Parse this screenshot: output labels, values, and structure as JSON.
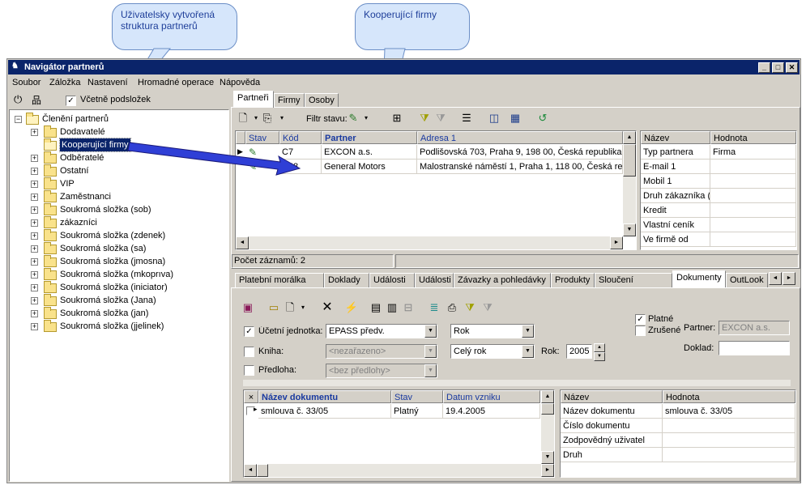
{
  "callouts": {
    "left": "Uživatelsky vytvořená struktura partnerů",
    "right": "Kooperující firmy"
  },
  "window": {
    "title": "Navigátor partnerů",
    "buttons": {
      "minimize": "_",
      "maximize": "□",
      "close": "✕"
    }
  },
  "menu": [
    "Soubor",
    "Záložka",
    "Nastavení",
    "Hromadné operace",
    "Nápověda"
  ],
  "left_toolbar": {
    "include_label": "Včetně podsložek",
    "include_checked": "✓"
  },
  "tree": {
    "root": "Členění partnerů",
    "items": [
      "Dodavatelé",
      "Kooperující firmy",
      "Odběratelé",
      "Ostatní",
      "VIP",
      "Zaměstnanci",
      "Soukromá složka (sob)",
      "zákazníci",
      "Soukromá složka (zdenek)",
      "Soukromá složka (sa)",
      "Soukromá složka (jmosna)",
      "Soukromá složka (mkoprıva)",
      "Soukromá složka (iniciator)",
      "Soukromá složka (Jana)",
      "Soukromá složka (jan)",
      "Soukromá složka (jjelinek)"
    ]
  },
  "top_tabs": [
    "Partneři",
    "Firmy",
    "Osoby"
  ],
  "filter_label": "Filtr stavu:",
  "grid": {
    "headers": [
      "Stav",
      "Kód",
      "Partner",
      "Adresa 1"
    ],
    "rows": [
      [
        "C7",
        "EXCON a.s.",
        "Podlišovská 703, Praha 9, 198 00, Česká republika"
      ],
      [
        "C48",
        "General Motors",
        "Malostranské náměstí 1, Praha 1, 118 00, Česká repu"
      ]
    ]
  },
  "props": {
    "headers": [
      "Název",
      "Hodnota"
    ],
    "rows": [
      [
        "Typ partnera",
        "Firma"
      ],
      [
        "E-mail 1",
        ""
      ],
      [
        "Mobil 1",
        ""
      ],
      [
        "Druh zákazníka (",
        ""
      ],
      [
        "Kredit",
        ""
      ],
      [
        "Vlastní ceník",
        ""
      ],
      [
        "Ve firmě od",
        ""
      ]
    ]
  },
  "status": "Počet záznamů: 2",
  "bottom_tabs": [
    "Platební morálka",
    "Doklady",
    "Události",
    "Události",
    "Závazky a pohledávky",
    "Produkty",
    "Sloučení partnerů",
    "Dokumenty",
    "OutLook"
  ],
  "doc_form": {
    "ucetni_label": "Účetní jednotka:",
    "ucetni_value": "EPASS předv.",
    "ucetni_checked": "✓",
    "kniha_label": "Kniha:",
    "kniha_value": "<nezařazeno>",
    "predloha_label": "Předloha:",
    "predloha_value": "<bez předlohy>",
    "period": "Rok",
    "period2": "Celý rok",
    "rok_label": "Rok:",
    "rok_value": "2005",
    "platne_label": "Platné",
    "platne_checked": "✓",
    "zrusene_label": "Zrušené",
    "partner_label": "Partner:",
    "partner_value": "EXCON a.s.",
    "doklad_label": "Doklad:"
  },
  "docs": {
    "headers": [
      "×",
      "Název dokumentu",
      "Stav",
      "Datum vzniku"
    ],
    "rows": [
      [
        "smlouva č. 33/05",
        "Platný",
        "19.4.2005"
      ]
    ]
  },
  "doc_props": {
    "headers": [
      "Název",
      "Hodnota"
    ],
    "rows": [
      [
        "Název dokumentu",
        "smlouva č. 33/05"
      ],
      [
        "Číslo dokumentu",
        ""
      ],
      [
        "Zodpovědný uživatel",
        ""
      ],
      [
        "Druh",
        ""
      ]
    ]
  }
}
